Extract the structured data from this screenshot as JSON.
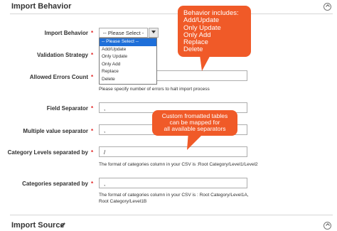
{
  "sections": {
    "import_behavior": {
      "title": "Import Behavior"
    },
    "import_source": {
      "title": "Import Source"
    }
  },
  "colors": {
    "callout": "#f05a28",
    "required": "#e22626",
    "selected": "#1e6fd9"
  },
  "icons": {
    "collapse": "chevron-up-icon",
    "edit": "pencil-icon"
  },
  "fields": {
    "import_behavior": {
      "label": "Import Behavior",
      "value": "-- Please Select --"
    },
    "validation_strategy": {
      "label": "Validation Strategy"
    },
    "allowed_errors": {
      "label": "Allowed Errors Count",
      "note": "Please specify number of errors to halt import process"
    },
    "field_separator": {
      "label": "Field Separator",
      "value": ","
    },
    "multiple_value_separator": {
      "label": "Multiple value separator",
      "value": ","
    },
    "category_levels_separator": {
      "label": "Category Levels separated by",
      "value": "/",
      "note": "The format of categories column in your CSV is :Root Category/Level1/Level2"
    },
    "categories_separator": {
      "label": "Categories separated by",
      "value": ",",
      "note_line1": "The format of categories column in your CSV is : Root Category/Level1A,",
      "note_line2": "Root Category/Level1B"
    }
  },
  "dropdown": {
    "options": [
      "-- Please Select --",
      "Add/Update",
      "Only Update",
      "Only Add",
      "Replace",
      "Delete"
    ]
  },
  "callouts": {
    "behavior": {
      "lines": [
        "Behavior includes:",
        "Add/Update",
        "Only Update",
        "Only Add",
        "Replace",
        "Delete"
      ]
    },
    "separators": {
      "lines": [
        "Custom fromatted tables",
        "can be mapped for",
        "all available separators"
      ]
    }
  }
}
